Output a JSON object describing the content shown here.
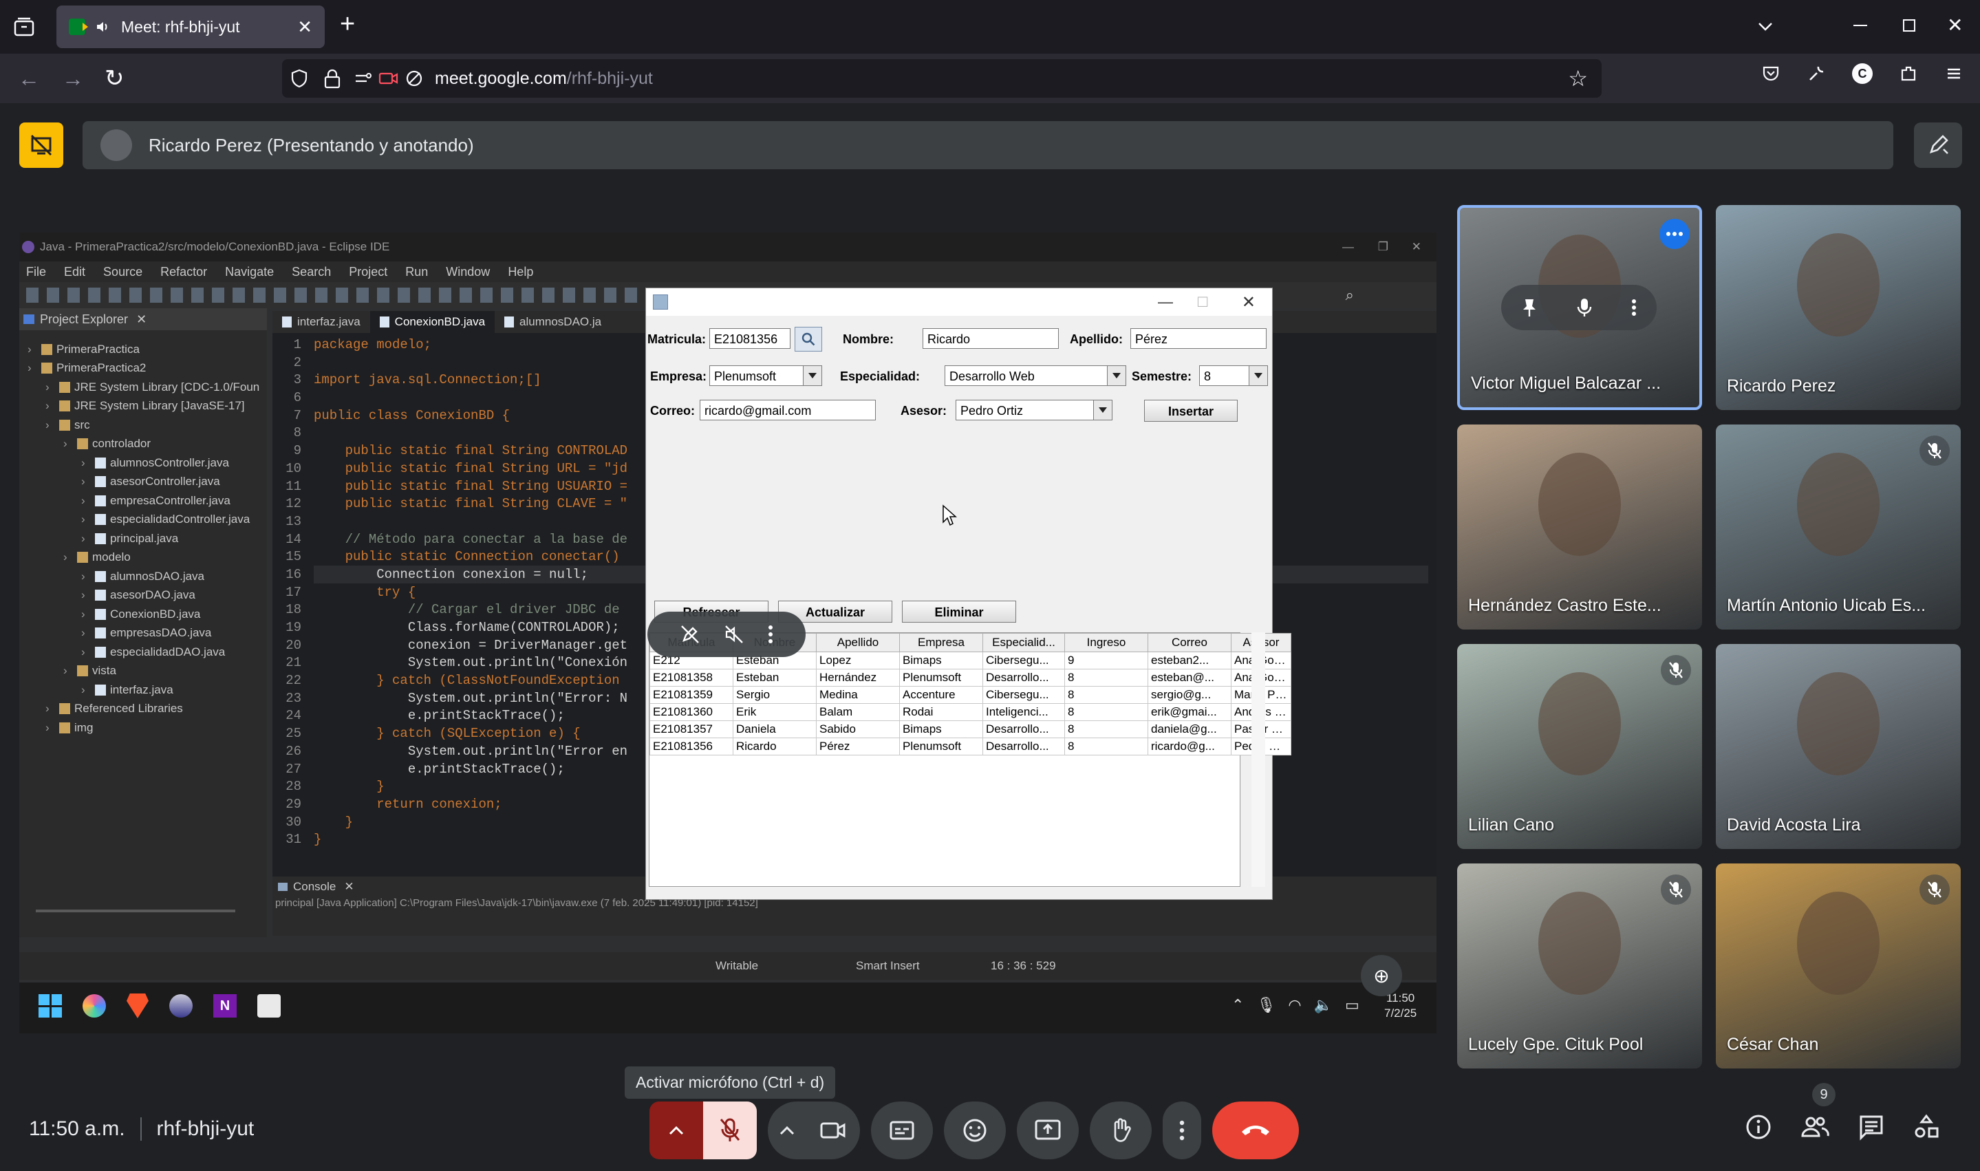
{
  "browser": {
    "tab_title": "Meet: rhf-bhji-yut",
    "url_host": "meet.google.com",
    "url_path": "/rhf-bhji-yut",
    "new_tab": "+"
  },
  "presenter": {
    "name": "Ricardo Perez (Presentando y anotando)"
  },
  "eclipse": {
    "title": "Java - PrimeraPractica2/src/modelo/ConexionBD.java - Eclipse IDE",
    "menu": [
      "File",
      "Edit",
      "Source",
      "Refactor",
      "Navigate",
      "Search",
      "Project",
      "Run",
      "Window",
      "Help"
    ],
    "explorer_title": "Project Explorer",
    "tree": [
      "PrimeraPractica",
      "PrimeraPractica2",
      "JRE System Library [CDC-1.0/Foun",
      "JRE System Library [JavaSE-17]",
      "src",
      "controlador",
      "alumnosController.java",
      "asesorController.java",
      "empresaController.java",
      "especialidadController.java",
      "principal.java",
      "modelo",
      "alumnosDAO.java",
      "asesorDAO.java",
      "ConexionBD.java",
      "empresasDAO.java",
      "especialidadDAO.java",
      "vista",
      "interfaz.java",
      "Referenced Libraries",
      "img"
    ],
    "editor_tabs": [
      "interfaz.java",
      "ConexionBD.java",
      "alumnosDAO.ja"
    ],
    "code": [
      {
        "n": "1",
        "t": "package modelo;"
      },
      {
        "n": "2",
        "t": ""
      },
      {
        "n": "3",
        "t": "import java.sql.Connection;[]"
      },
      {
        "n": "6",
        "t": ""
      },
      {
        "n": "7",
        "t": "public class ConexionBD {"
      },
      {
        "n": "8",
        "t": ""
      },
      {
        "n": "9",
        "t": "    public static final String CONTROLAD"
      },
      {
        "n": "10",
        "t": "    public static final String URL = \"jd"
      },
      {
        "n": "11",
        "t": "    public static final String USUARIO ="
      },
      {
        "n": "12",
        "t": "    public static final String CLAVE = \""
      },
      {
        "n": "13",
        "t": ""
      },
      {
        "n": "14",
        "t": "    // Método para conectar a la base de"
      },
      {
        "n": "15",
        "t": "    public static Connection conectar()"
      },
      {
        "n": "16",
        "t": "        Connection conexion = null;"
      },
      {
        "n": "17",
        "t": "        try {"
      },
      {
        "n": "18",
        "t": "            // Cargar el driver JDBC de"
      },
      {
        "n": "19",
        "t": "            Class.forName(CONTROLADOR);"
      },
      {
        "n": "20",
        "t": "            conexion = DriverManager.get"
      },
      {
        "n": "21",
        "t": "            System.out.println(\"Conexión"
      },
      {
        "n": "22",
        "t": "        } catch (ClassNotFoundException"
      },
      {
        "n": "23",
        "t": "            System.out.println(\"Error: N"
      },
      {
        "n": "24",
        "t": "            e.printStackTrace();"
      },
      {
        "n": "25",
        "t": "        } catch (SQLException e) {"
      },
      {
        "n": "26",
        "t": "            System.out.println(\"Error en"
      },
      {
        "n": "27",
        "t": "            e.printStackTrace();"
      },
      {
        "n": "28",
        "t": "        }"
      },
      {
        "n": "29",
        "t": "        return conexion;"
      },
      {
        "n": "30",
        "t": "    }"
      },
      {
        "n": "31",
        "t": "}"
      }
    ],
    "console_title": "Console",
    "console_line": "principal [Java Application] C:\\Program Files\\Java\\jdk-17\\bin\\javaw.exe (7 feb. 2025 11:49:01) [pid: 14152]",
    "status": {
      "writable": "Writable",
      "insert": "Smart Insert",
      "position": "16 : 36 : 529"
    }
  },
  "form": {
    "matricula_label": "Matricula:",
    "matricula_value": "E21081356",
    "nombre_label": "Nombre:",
    "nombre_value": "Ricardo",
    "apellido_label": "Apellido:",
    "apellido_value": "Pérez",
    "empresa_label": "Empresa:",
    "empresa_value": "Plenumsoft",
    "especialidad_label": "Especialidad:",
    "especialidad_value": "Desarrollo Web",
    "semestre_label": "Semestre:",
    "semestre_value": "8",
    "correo_label": "Correo:",
    "correo_value": "ricardo@gmail.com",
    "asesor_label": "Asesor:",
    "asesor_value": "Pedro Ortiz",
    "insertar": "Insertar",
    "refrescar": "Refrescar",
    "actualizar": "Actualizar",
    "eliminar": "Eliminar",
    "columns": [
      "Matricula",
      "Nombre",
      "Apellido",
      "Empresa",
      "Especialid...",
      "Ingreso",
      "Correo",
      "Asesor"
    ],
    "rows": [
      [
        "E212",
        "Esteban",
        "Lopez",
        "Bimaps",
        "Cibersegu...",
        "9",
        "esteban2...",
        "Ana Gonzá..."
      ],
      [
        "E21081358",
        "Esteban",
        "Hernández",
        "Plenumsoft",
        "Desarrollo...",
        "8",
        "esteban@...",
        "Ana Gonzá..."
      ],
      [
        "E21081359",
        "Sergio",
        "Medina",
        "Accenture",
        "Cibersegu...",
        "8",
        "sergio@g...",
        "Marta Pérez"
      ],
      [
        "E21081360",
        "Erik",
        "Balam",
        "Rodai",
        "Inteligenci...",
        "8",
        "erik@gmai...",
        "Andrés Ló..."
      ],
      [
        "E21081357",
        "Daniela",
        "Sabido",
        "Bimaps",
        "Desarrollo...",
        "8",
        "daniela@g...",
        "Pastor Go..."
      ],
      [
        "E21081356",
        "Ricardo",
        "Pérez",
        "Plenumsoft",
        "Desarrollo...",
        "8",
        "ricardo@g...",
        "Pedro Ortiz"
      ]
    ]
  },
  "taskbar": {
    "time": "11:50",
    "date": "7/2/25"
  },
  "participants": [
    {
      "name": "Victor Miguel Balcazar ...",
      "muted": false
    },
    {
      "name": "Ricardo Perez",
      "muted": false
    },
    {
      "name": "Hernández Castro Este...",
      "muted": false
    },
    {
      "name": "Martín Antonio Uicab Es...",
      "muted": true
    },
    {
      "name": "Lilian Cano",
      "muted": true
    },
    {
      "name": "David Acosta Lira",
      "muted": false
    },
    {
      "name": "Lucely Gpe. Cituk Pool",
      "muted": true
    },
    {
      "name": "César Chan",
      "muted": true
    }
  ],
  "bottom": {
    "time": "11:50 a.m.",
    "meeting_code": "rhf-bhji-yut",
    "tooltip": "Activar micrófono (Ctrl + d)",
    "people_count": "9"
  },
  "colors": {
    "meet_bg": "#202124",
    "end_call": "#ea4335",
    "mic_off": "#f9dedc",
    "mic_off_dark": "#8c1d18",
    "active_tile_border": "#8ab4f8",
    "presenting_badge": "#fbbc04"
  }
}
